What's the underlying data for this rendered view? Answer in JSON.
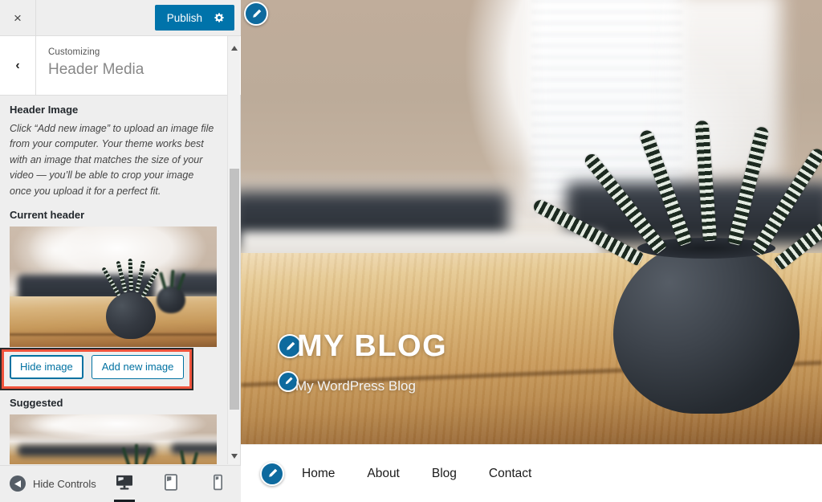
{
  "customizer": {
    "close_label": "×",
    "publish_label": "Publish",
    "gear_icon": "gear-icon",
    "back_label": "‹",
    "eyebrow": "Customizing",
    "panel_title": "Header Media",
    "accent_color": "#0073aa",
    "highlight_color": "#f0533c"
  },
  "header_image_section": {
    "title": "Header Image",
    "description": "Click “Add new image” to upload an image file from your computer. Your theme works best with an image that matches the size of your video — you’ll be able to crop your image once you upload it for a perfect fit.",
    "current_header_label": "Current header",
    "hide_image_label": "Hide image",
    "add_new_image_label": "Add new image",
    "suggested_label": "Suggested"
  },
  "bottom_bar": {
    "hide_controls_label": "Hide Controls",
    "devices": [
      {
        "name": "desktop",
        "label": "Desktop",
        "active": true
      },
      {
        "name": "tablet",
        "label": "Tablet",
        "active": false
      },
      {
        "name": "mobile",
        "label": "Mobile",
        "active": false
      }
    ]
  },
  "preview": {
    "site_title": "MY BLOG",
    "site_tagline": "My WordPress Blog",
    "nav_items": [
      {
        "label": "Home"
      },
      {
        "label": "About"
      },
      {
        "label": "Blog"
      },
      {
        "label": "Contact"
      }
    ]
  }
}
